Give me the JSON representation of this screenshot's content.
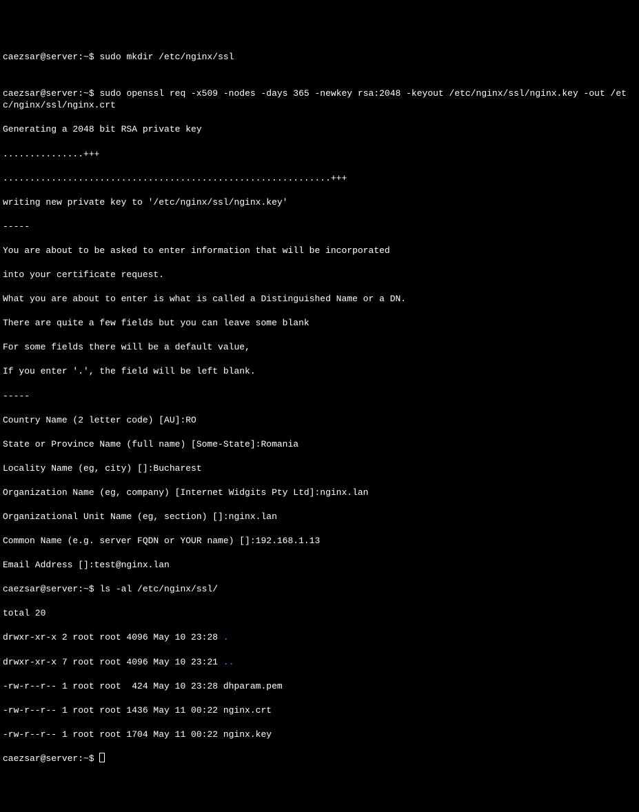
{
  "prompt": "caezsar@server:~$ ",
  "commands": {
    "cmd1": "sudo mkdir /etc/nginx/ssl",
    "cmd2": "sudo openssl req -x509 -nodes -days 365 -newkey rsa:2048 -keyout /etc/nginx/ssl/nginx.key -out /etc/nginx/ssl/nginx.crt",
    "cmd3": "ls -al /etc/nginx/ssl/"
  },
  "output": {
    "gen_key": "Generating a 2048 bit RSA private key",
    "dots1": "...............+++",
    "dots2": ".............................................................+++",
    "writing": "writing new private key to '/etc/nginx/ssl/nginx.key'",
    "dashes": "-----",
    "about1": "You are about to be asked to enter information that will be incorporated",
    "about2": "into your certificate request.",
    "about3": "What you are about to enter is what is called a Distinguished Name or a DN.",
    "about4": "There are quite a few fields but you can leave some blank",
    "about5": "For some fields there will be a default value,",
    "about6": "If you enter '.', the field will be left blank.",
    "country": "Country Name (2 letter code) [AU]:RO",
    "state": "State or Province Name (full name) [Some-State]:Romania",
    "locality": "Locality Name (eg, city) []:Bucharest",
    "org": "Organization Name (eg, company) [Internet Widgits Pty Ltd]:nginx.lan",
    "orgunit": "Organizational Unit Name (eg, section) []:nginx.lan",
    "common": "Common Name (e.g. server FQDN or YOUR name) []:192.168.1.13",
    "email": "Email Address []:test@nginx.lan",
    "total": "total 20",
    "ls1_perms": "drwxr-xr-x 2 root root 4096 May 10 23:28 ",
    "ls1_name": ".",
    "ls2_perms": "drwxr-xr-x 7 root root 4096 May 10 23:21 ",
    "ls2_name": "..",
    "ls3": "-rw-r--r-- 1 root root  424 May 10 23:28 dhparam.pem",
    "ls4": "-rw-r--r-- 1 root root 1436 May 11 00:22 nginx.crt",
    "ls5": "-rw-r--r-- 1 root root 1704 May 11 00:22 nginx.key"
  }
}
